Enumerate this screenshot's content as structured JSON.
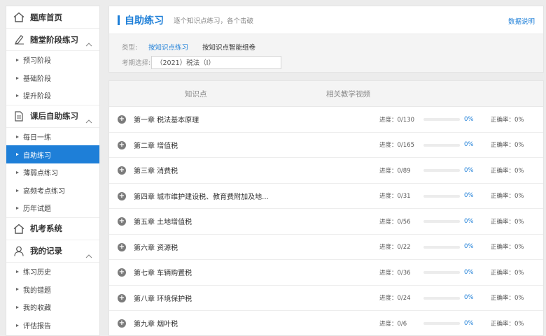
{
  "sidebar": {
    "home": "题库首页",
    "sections": [
      {
        "title": "随堂阶段练习",
        "icon": "pen-icon",
        "items": [
          "预习阶段",
          "基础阶段",
          "提升阶段"
        ]
      },
      {
        "title": "课后自助练习",
        "icon": "document-icon",
        "items": [
          "每日一练",
          "自助练习",
          "薄弱点练习",
          "高频考点练习",
          "历年试题"
        ]
      }
    ],
    "exam": "机考系统",
    "records": {
      "title": "我的记录",
      "items": [
        "练习历史",
        "我的错题",
        "我的收藏",
        "评估报告"
      ]
    },
    "active_item": "自助练习"
  },
  "header": {
    "title": "自助练习",
    "desc": "逐个知识点练习，各个击破",
    "link": "数据说明"
  },
  "filters": {
    "type_label": "类型:",
    "type_options": [
      "按知识点练习",
      "按知识点智能组卷"
    ],
    "period_label": "考期选择:",
    "period_value": "（2021）税法（Ⅰ）"
  },
  "tabs": [
    "知识点",
    "相关教学视频"
  ],
  "chapters": [
    {
      "name": "第一章 税法基本原理",
      "progress": "进度：0/130",
      "ratio": 0,
      "pct": "0%",
      "accuracy": "正确率：0%"
    },
    {
      "name": "第二章 增值税",
      "progress": "进度：0/165",
      "ratio": 0,
      "pct": "0%",
      "accuracy": "正确率：0%"
    },
    {
      "name": "第三章 消费税",
      "progress": "进度：0/89",
      "ratio": 0,
      "pct": "0%",
      "accuracy": "正确率：0%"
    },
    {
      "name": "第四章 城市维护建设税、教育费附加及地...",
      "progress": "进度：0/31",
      "ratio": 0,
      "pct": "0%",
      "accuracy": "正确率：0%"
    },
    {
      "name": "第五章 土地增值税",
      "progress": "进度：0/56",
      "ratio": 0,
      "pct": "0%",
      "accuracy": "正确率：0%"
    },
    {
      "name": "第六章 资源税",
      "progress": "进度：0/22",
      "ratio": 0,
      "pct": "0%",
      "accuracy": "正确率：0%"
    },
    {
      "name": "第七章 车辆购置税",
      "progress": "进度：0/36",
      "ratio": 0,
      "pct": "0%",
      "accuracy": "正确率：0%"
    },
    {
      "name": "第八章 环境保护税",
      "progress": "进度：0/24",
      "ratio": 0,
      "pct": "0%",
      "accuracy": "正确率：0%"
    },
    {
      "name": "第九章 烟叶税",
      "progress": "进度：0/6",
      "ratio": 0,
      "pct": "0%",
      "accuracy": "正确率：0%"
    }
  ],
  "colors": {
    "accent": "#1e7fd8"
  }
}
